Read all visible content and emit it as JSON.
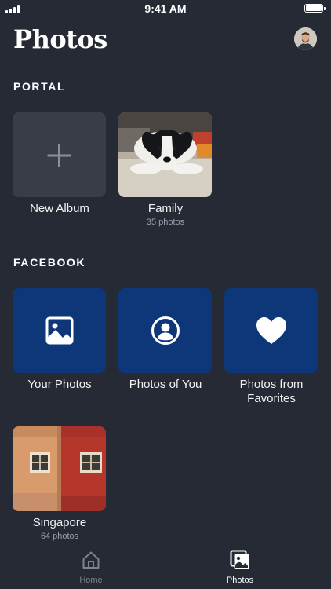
{
  "status": {
    "time": "9:41 AM"
  },
  "header": {
    "title": "Photos"
  },
  "sections": {
    "portal": {
      "label": "PORTAL",
      "new_album": {
        "label": "New Album"
      },
      "albums": [
        {
          "name": "Family",
          "count": "35 photos"
        }
      ]
    },
    "facebook": {
      "label": "FACEBOOK",
      "items": [
        {
          "name": "Your Photos",
          "icon": "image-icon"
        },
        {
          "name": "Photos of You",
          "icon": "person-icon"
        },
        {
          "name": "Photos from Favorites",
          "icon": "heart-icon"
        }
      ],
      "albums": [
        {
          "name": "Singapore",
          "count": "64 photos"
        }
      ]
    }
  },
  "tabbar": {
    "tabs": [
      {
        "label": "Home",
        "icon": "home-icon",
        "active": false
      },
      {
        "label": "Photos",
        "icon": "photos-icon",
        "active": true
      }
    ]
  },
  "colors": {
    "background": "#252a35",
    "tile_empty": "#383d47",
    "facebook_tile": "#0d3779",
    "active_tab": "#ffffff",
    "inactive_tab": "#7d828c"
  }
}
